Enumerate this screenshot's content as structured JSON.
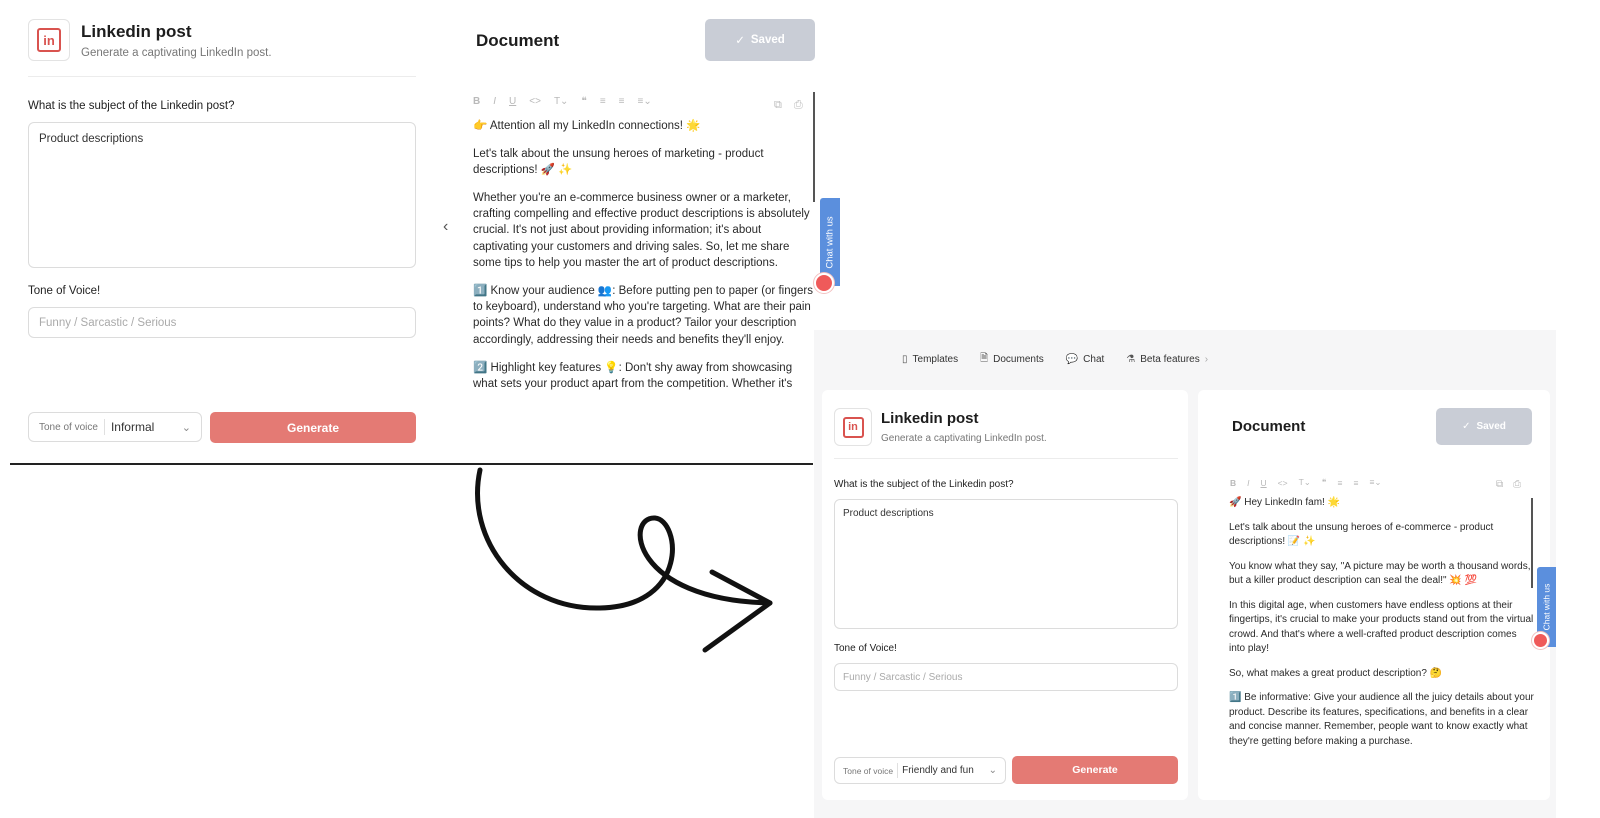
{
  "before": {
    "form": {
      "title": "Linkedin post",
      "subtitle": "Generate a captivating LinkedIn post.",
      "logo_text": "in",
      "subject_label": "What is the subject of the Linkedin post?",
      "subject_value": "Product descriptions",
      "tone_label": "Tone of Voice!",
      "tone_placeholder": "Funny / Sarcastic / Serious",
      "select_label": "Tone of voice",
      "select_value": "Informal",
      "generate_label": "Generate"
    },
    "document": {
      "title": "Document",
      "saved_label": "Saved",
      "chat_label": "Chat with us",
      "paragraphs": [
        "👉 Attention all my LinkedIn connections! 🌟",
        "Let's talk about the unsung heroes of marketing - product descriptions! 🚀 ✨",
        "Whether you're an e-commerce business owner or a marketer, crafting compelling and effective product descriptions is absolutely crucial. It's not just about providing information; it's about captivating your customers and driving sales. So, let me share some tips to help you master the art of product descriptions.",
        "1️⃣ Know your audience 👥: Before putting pen to paper (or fingers to keyboard), understand who you're targeting. What are their pain points? What do they value in a product? Tailor your description accordingly, addressing their needs and benefits they'll enjoy.",
        "2️⃣ Highlight key features 💡: Don't shy away from showcasing what sets your product apart from the competition. Whether it's"
      ]
    }
  },
  "after": {
    "nav": [
      {
        "icon": "templates-icon",
        "label": "Templates"
      },
      {
        "icon": "documents-icon",
        "label": "Documents"
      },
      {
        "icon": "chat-icon",
        "label": "Chat"
      },
      {
        "icon": "beta-icon",
        "label": "Beta features"
      }
    ],
    "form": {
      "title": "Linkedin post",
      "subtitle": "Generate a captivating LinkedIn post.",
      "logo_text": "in",
      "subject_label": "What is the subject of the Linkedin post?",
      "subject_value": "Product descriptions",
      "tone_label": "Tone of Voice!",
      "tone_placeholder": "Funny / Sarcastic / Serious",
      "select_label": "Tone of voice",
      "select_value": "Friendly and fun",
      "generate_label": "Generate"
    },
    "document": {
      "title": "Document",
      "saved_label": "Saved",
      "chat_label": "Chat with us",
      "paragraphs": [
        "🚀 Hey LinkedIn fam! 🌟",
        "Let's talk about the unsung heroes of e-commerce - product descriptions! 📝 ✨",
        "You know what they say, \"A picture may be worth a thousand words, but a killer product description can seal the deal!\" 💥 💯",
        "In this digital age, when customers have endless options at their fingertips, it's crucial to make your products stand out from the virtual crowd. And that's where a well-crafted product description comes into play!",
        "So, what makes a great product description? 🤔",
        "1️⃣ Be informative: Give your audience all the juicy details about your product. Describe its features, specifications, and benefits in a clear and concise manner. Remember, people want to know exactly what they're getting before making a purchase."
      ]
    }
  },
  "toolbar_glyphs": [
    "B",
    "I",
    "U",
    "<>",
    "T",
    "❝",
    "≡",
    "≡",
    "≡"
  ],
  "colors": {
    "generate": "#e47a74",
    "saved": "#c9cdd6",
    "chat_tab": "#5b8fdd",
    "logo": "#d9534f"
  }
}
